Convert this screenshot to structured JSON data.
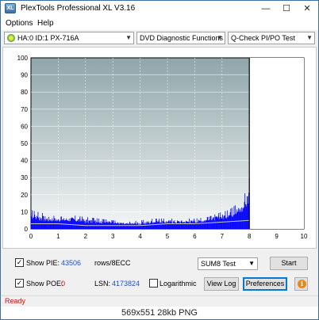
{
  "window": {
    "title": "PlexTools Professional XL V3.16",
    "minimize": "—",
    "maximize": "☐",
    "close": "✕",
    "icon_label": "XL"
  },
  "menu": {
    "items": [
      "Options",
      "Help"
    ]
  },
  "toolbar": {
    "drive": "HA:0 ID:1  PX-716A",
    "function": "DVD Diagnostic Functions",
    "test": "Q-Check PI/PO Test"
  },
  "chart_data": {
    "type": "area",
    "x_ticks": [
      "0",
      "1",
      "2",
      "3",
      "4",
      "5",
      "6",
      "7",
      "8",
      "9",
      "10"
    ],
    "y_ticks": [
      "0",
      "10",
      "20",
      "30",
      "40",
      "50",
      "60",
      "70",
      "80",
      "90",
      "100"
    ],
    "xlim": [
      0,
      10
    ],
    "ylim": [
      0,
      100
    ],
    "grid": true,
    "marker_x": 8,
    "series": [
      {
        "color": "#0000ff",
        "x": [
          0,
          0.5,
          1,
          1.5,
          2,
          2.5,
          3,
          3.5,
          4,
          4.5,
          5,
          5.5,
          6,
          6.5,
          7,
          7.25,
          7.5,
          7.75,
          7.9,
          8
        ],
        "y_max": [
          11,
          9,
          7,
          8,
          7,
          6,
          5,
          4,
          5,
          6,
          6,
          6,
          6,
          7,
          10,
          11,
          14,
          16,
          24,
          30
        ],
        "y_avg": [
          5,
          4,
          4,
          4,
          3,
          3,
          3,
          2,
          2,
          3,
          3,
          3,
          3,
          4,
          5,
          6,
          7,
          9,
          11,
          14
        ]
      },
      {
        "color": "#c8c8c8",
        "x": [
          0,
          1,
          2,
          3,
          4,
          5,
          6,
          7,
          8
        ],
        "y": [
          3,
          3,
          2,
          2,
          2,
          3,
          3,
          4,
          5
        ]
      }
    ]
  },
  "controls": {
    "show_pie_label": "Show PIE:",
    "show_pie_checked": "✓",
    "pie_value": "43506",
    "rows_label": "rows/8ECC",
    "show_poe_label": "Show POE:",
    "show_poe_checked": "✓",
    "poe_value": "0",
    "lsn_label": "LSN:",
    "lsn_value": "4173824",
    "log_label": "Logarithmic",
    "sum_select": "SUM8 Test",
    "start_button": "Start",
    "view_log_button": "View Log",
    "preferences_button": "Preferences",
    "info_icon": "i"
  },
  "status": {
    "text": "Ready"
  },
  "caption": {
    "text": "569x551  28kb  PNG"
  }
}
